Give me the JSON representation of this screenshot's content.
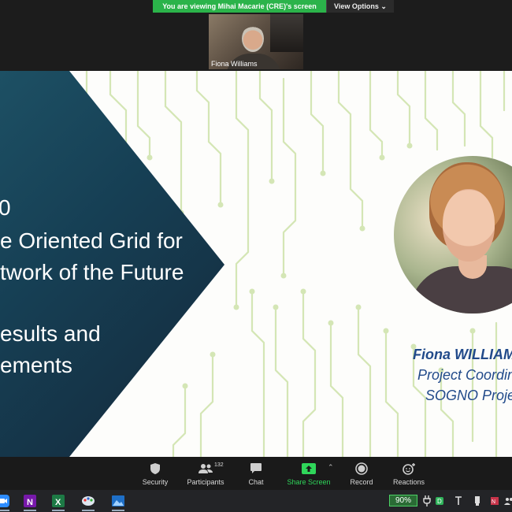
{
  "share_banner": {
    "viewing_text": "You are viewing Mihai Macarie (CRE)'s screen",
    "view_options_label": "View Options"
  },
  "video_tile": {
    "participant_name": "Fiona Williams"
  },
  "slide": {
    "title_lines": [
      "0",
      "e Oriented Grid for",
      "twork of the Future",
      "esults and",
      "ements"
    ],
    "presenter_name": "Fiona WILLIAM",
    "presenter_role": "Project Coordin",
    "presenter_project": "SOGNO Proje",
    "colors": {
      "panel": "#163f54",
      "caption": "#214a8a",
      "circuit": "#d4e6b5"
    }
  },
  "controls": {
    "items": [
      {
        "label": "Security",
        "icon": "shield-icon"
      },
      {
        "label": "Participants",
        "icon": "participants-icon",
        "count": "132"
      },
      {
        "label": "Chat",
        "icon": "chat-icon"
      },
      {
        "label": "Share Screen",
        "icon": "share-screen-icon"
      },
      {
        "label": "Record",
        "icon": "record-icon"
      },
      {
        "label": "Reactions",
        "icon": "reactions-icon"
      }
    ],
    "share_color": "#2fd65a"
  },
  "taskbar": {
    "battery_percent": "90%",
    "apps": [
      "zoom-app-icon",
      "onenote-app-icon",
      "excel-app-icon",
      "paint-app-icon",
      "photos-app-icon"
    ]
  }
}
